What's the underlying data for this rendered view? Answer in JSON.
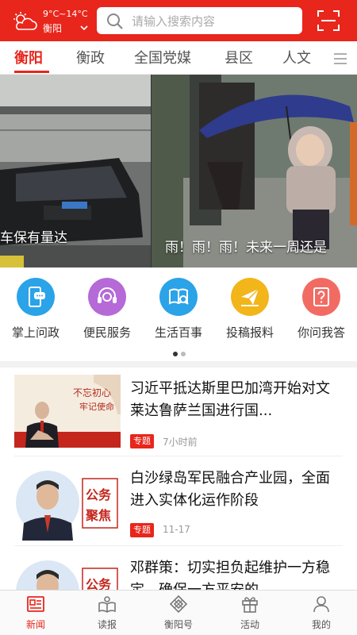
{
  "header": {
    "weather_temp": "9°C~14°C",
    "city": "衡阳",
    "weather_icon": "cloudy-sun-icon",
    "search_placeholder": "请输入搜索内容",
    "scan_icon": "scan-icon",
    "brand_color": "#e8261c"
  },
  "tabs": [
    {
      "label": "衡阳",
      "active": true
    },
    {
      "label": "衡政",
      "active": false
    },
    {
      "label": "全国党媒",
      "active": false
    },
    {
      "label": "县区",
      "active": false
    },
    {
      "label": "人文",
      "active": false
    }
  ],
  "banner": {
    "slides": [
      {
        "caption": "车保有量达"
      },
      {
        "caption": "雨！雨！雨！未来一周还是"
      }
    ]
  },
  "services": [
    {
      "label": "掌上问政",
      "icon": "phone-chat-icon",
      "color": "#2aa3e8"
    },
    {
      "label": "便民服务",
      "icon": "headset-icon",
      "color": "#b56ad8"
    },
    {
      "label": "生活百事",
      "icon": "book-search-icon",
      "color": "#2aa3e8"
    },
    {
      "label": "投稿报料",
      "icon": "paper-plane-icon",
      "color": "#f2b51a"
    },
    {
      "label": "你问我答",
      "icon": "question-doc-icon",
      "color": "#f26b63"
    }
  ],
  "pager": {
    "total": 2,
    "current": 1
  },
  "news": [
    {
      "title": "习近平抵达斯里巴加湾开始对文莱达鲁萨兰国进行国...",
      "tag": "专题",
      "time": "7小时前",
      "thumb_text": [
        "不忘初心",
        "牢记使命"
      ]
    },
    {
      "title": "白沙绿岛军民融合产业园，全面进入实体化运作阶段",
      "tag": "专题",
      "time": "11-17",
      "thumb_text": [
        "公务",
        "聚焦"
      ]
    },
    {
      "title": "邓群策：切实担负起维护一方稳定、确保一方平安的",
      "tag": "",
      "time": "",
      "thumb_text": [
        "公务",
        "聚焦"
      ]
    }
  ],
  "bottom_nav": [
    {
      "label": "新闻",
      "icon": "newspaper-icon",
      "active": true
    },
    {
      "label": "读报",
      "icon": "read-paper-icon",
      "active": false
    },
    {
      "label": "衡阳号",
      "icon": "diamond-grid-icon",
      "active": false
    },
    {
      "label": "活动",
      "icon": "gift-icon",
      "active": false
    },
    {
      "label": "我的",
      "icon": "user-icon",
      "active": false
    }
  ]
}
